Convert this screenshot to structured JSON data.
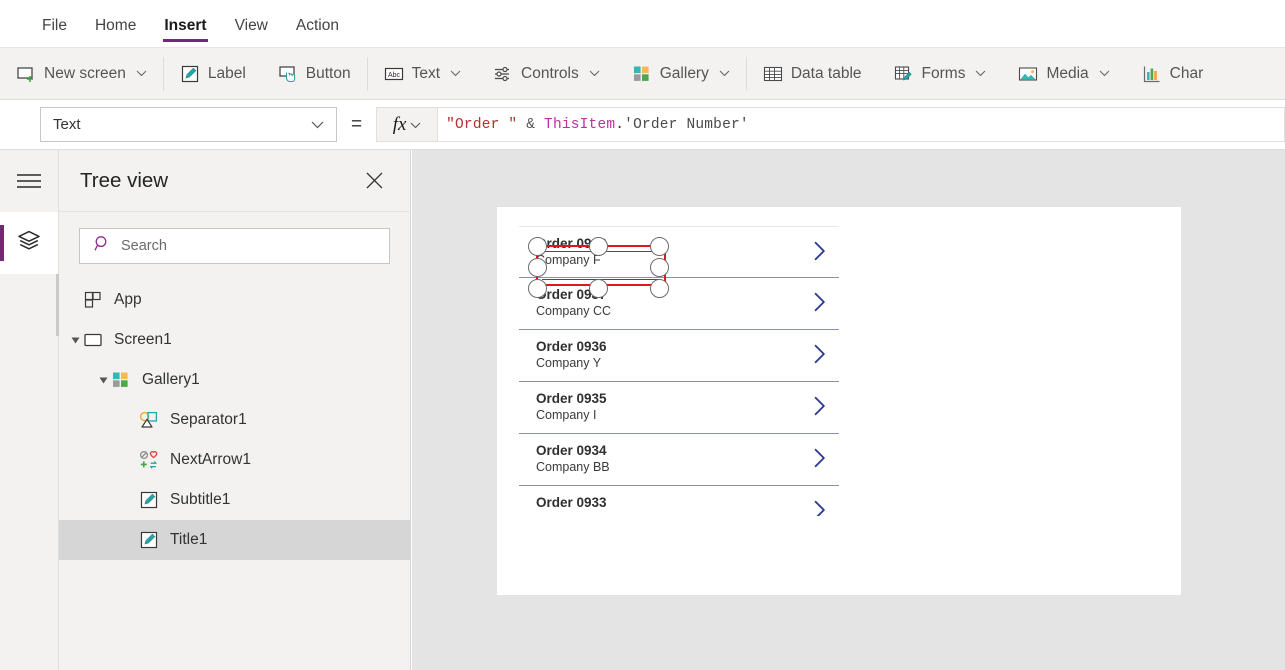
{
  "menubar": {
    "tabs": [
      {
        "label": "File",
        "active": false
      },
      {
        "label": "Home",
        "active": false
      },
      {
        "label": "Insert",
        "active": true
      },
      {
        "label": "View",
        "active": false
      },
      {
        "label": "Action",
        "active": false
      }
    ],
    "active_underline_color": "#742774"
  },
  "ribbon": {
    "items": [
      {
        "label": "New screen",
        "icon": "new-screen-icon",
        "has_chevron": true
      },
      {
        "label": "Label",
        "icon": "label-icon",
        "has_chevron": false
      },
      {
        "label": "Button",
        "icon": "button-icon",
        "has_chevron": false
      },
      {
        "label": "Text",
        "icon": "text-abc-icon",
        "has_chevron": true
      },
      {
        "label": "Controls",
        "icon": "controls-icon",
        "has_chevron": true
      },
      {
        "label": "Gallery",
        "icon": "gallery-icon",
        "has_chevron": true
      },
      {
        "label": "Data table",
        "icon": "data-table-icon",
        "has_chevron": false
      },
      {
        "label": "Forms",
        "icon": "forms-icon",
        "has_chevron": true
      },
      {
        "label": "Media",
        "icon": "media-icon",
        "has_chevron": true
      },
      {
        "label": "Char",
        "icon": "charts-icon",
        "has_chevron": false
      }
    ]
  },
  "formula_bar": {
    "property": "Text",
    "equals": "=",
    "fx_label": "fx",
    "formula_tokens": [
      {
        "text": "\"Order \"",
        "kind": "string"
      },
      {
        "text": " & ",
        "kind": "operator"
      },
      {
        "text": "ThisItem",
        "kind": "thisitem"
      },
      {
        "text": ".",
        "kind": "dot"
      },
      {
        "text": "'Order Number'",
        "kind": "field"
      }
    ],
    "formula_plain": "\"Order \" & ThisItem.'Order Number'"
  },
  "left_rail": {
    "menu_icon": "hamburger-icon",
    "active_icon": "tree-view-layers-icon",
    "accent": "#742774"
  },
  "tree_panel": {
    "title": "Tree view",
    "close_icon": "close-icon",
    "search": {
      "placeholder": "Search",
      "value": "",
      "icon": "search-icon"
    },
    "items": [
      {
        "label": "App",
        "icon": "app-icon",
        "indent": 0,
        "caret": "none",
        "selected": false
      },
      {
        "label": "Screen1",
        "icon": "screen-icon",
        "indent": 0,
        "caret": "expanded",
        "selected": false
      },
      {
        "label": "Gallery1",
        "icon": "gallery-icon",
        "indent": 1,
        "caret": "expanded",
        "selected": false
      },
      {
        "label": "Separator1",
        "icon": "separator-icon",
        "indent": 2,
        "caret": "none",
        "selected": false
      },
      {
        "label": "NextArrow1",
        "icon": "next-arrow-icon",
        "indent": 2,
        "caret": "none",
        "selected": false
      },
      {
        "label": "Subtitle1",
        "icon": "label-icon",
        "indent": 2,
        "caret": "none",
        "selected": false
      },
      {
        "label": "Title1",
        "icon": "label-icon",
        "indent": 2,
        "caret": "none",
        "selected": true
      }
    ]
  },
  "canvas": {
    "background": "#e4e4e4",
    "screen_background": "#ffffff",
    "selection": {
      "color": "#e81123",
      "handle_count": 8,
      "target_control": "Title1"
    },
    "gallery": {
      "chevron_icon": "chevron-right-icon",
      "chevron_color": "#2b3a8f",
      "separator_color": "#8890b5",
      "rows": [
        {
          "title": "Order 0938",
          "subtitle": "Company F",
          "selected": true,
          "clipped": false
        },
        {
          "title": "Order 0937",
          "subtitle": "Company CC",
          "selected": false,
          "clipped": false
        },
        {
          "title": "Order 0936",
          "subtitle": "Company Y",
          "selected": false,
          "clipped": false
        },
        {
          "title": "Order 0935",
          "subtitle": "Company I",
          "selected": false,
          "clipped": false
        },
        {
          "title": "Order 0934",
          "subtitle": "Company BB",
          "selected": false,
          "clipped": false
        },
        {
          "title": "Order 0933",
          "subtitle": "",
          "selected": false,
          "clipped": true
        }
      ]
    }
  }
}
